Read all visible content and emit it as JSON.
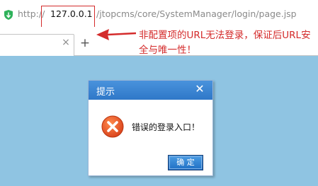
{
  "browser": {
    "url_scheme": "http://",
    "url_host": "127.0.0.1",
    "url_path": "/jtopcms/core/SystemManager/login/page.jsp",
    "tab_close_icon": "×",
    "new_tab_icon": "+"
  },
  "annotation": {
    "text": "非配置项的URL无法登录，保证后URL安全与唯一性！",
    "color": "#d42b2b"
  },
  "dialog": {
    "title": "提示",
    "close_icon": "✕",
    "message": "错误的登录入口！",
    "ok_label": "确 定",
    "header_color": "#3a86d4",
    "error_icon_color": "#ec5a1e"
  },
  "page": {
    "background": "#8fc4e2"
  }
}
